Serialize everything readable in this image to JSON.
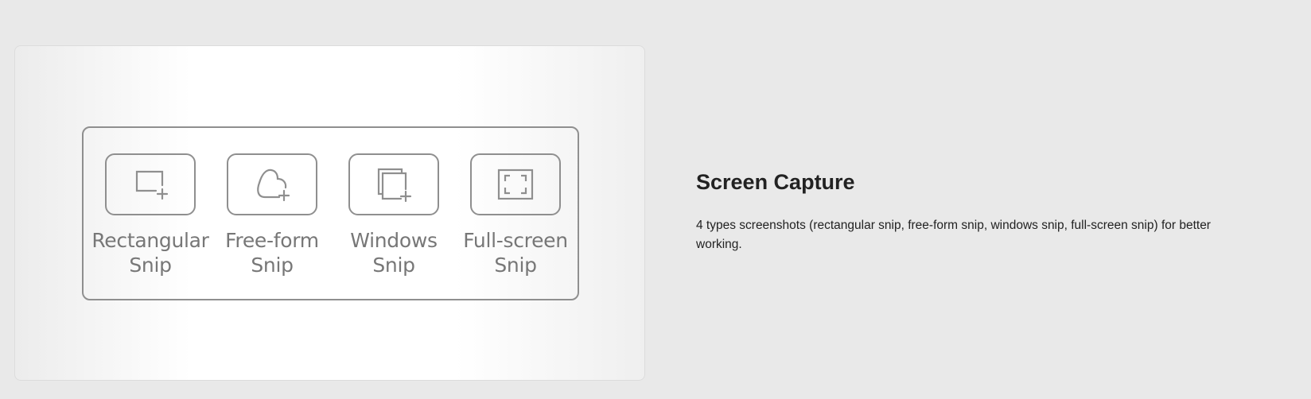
{
  "feature": {
    "title": "Screen Capture",
    "description": "4 types screenshots (rectangular snip, free-form snip, windows snip, full-screen snip) for better working."
  },
  "snip_types": [
    {
      "icon": "rectangular-snip-icon",
      "label_line1": "Rectangular",
      "label_line2": "Snip"
    },
    {
      "icon": "free-form-snip-icon",
      "label_line1": "Free-form",
      "label_line2": "Snip"
    },
    {
      "icon": "windows-snip-icon",
      "label_line1": "Windows",
      "label_line2": "Snip"
    },
    {
      "icon": "full-screen-snip-icon",
      "label_line1": "Full-screen",
      "label_line2": "Snip"
    }
  ],
  "colors": {
    "page_background": "#e9e9e9",
    "outline_gray": "#8f8f8f",
    "label_gray": "#777777",
    "text": "#222222"
  }
}
